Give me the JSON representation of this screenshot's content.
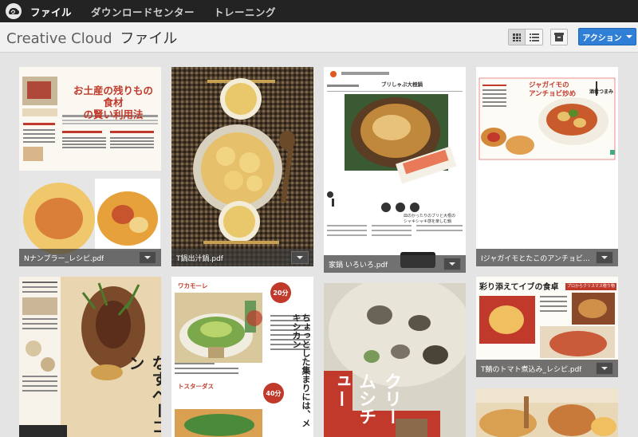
{
  "nav": {
    "items": [
      {
        "label": "ファイル"
      },
      {
        "label": "ダウンロードセンター"
      },
      {
        "label": "トレーニング"
      }
    ]
  },
  "header": {
    "brand": "Creative Cloud",
    "section": "ファイル",
    "action_label": "アクション"
  },
  "files": [
    {
      "name": "Nナンプラー_レシピ.pdf"
    },
    {
      "name": "T鍋出汁鍋.pdf"
    },
    {
      "name": "家鍋 いろいろ.pdf"
    },
    {
      "name": "Iジャガイモとたこのアンチョビ炒..."
    },
    {
      "name": ""
    },
    {
      "name": ""
    },
    {
      "name": ""
    },
    {
      "name": "T鯖のトマト煮込み_レシピ.pdf"
    },
    {
      "name": ""
    }
  ],
  "thumb_text": {
    "t1_headline1": "お土産の残りもの食材",
    "t1_headline2": "の賢い利用法",
    "t3_title": "ブリしゃぶ大根鍋",
    "t3_caption1": "皿のかったりのブリと大根の",
    "t3_caption2": "シャキシャキ感を楽しむ鍋",
    "t4_title1": "ジャガイモの",
    "t4_title2": "アンチョビ炒め",
    "t4_tag": "酒肴つまみ",
    "t6_label1": "ワカモーレ",
    "t6_badge1": "20分",
    "t6_label2": "トスターダス",
    "t6_badge2": "40分",
    "t6_vertical": "ちょっとした集まりには、メキシカン",
    "t5_vertical": "なすベーコン",
    "t7_vertical": "クリームシチュー",
    "t8_header": "彩り添えてイブの食卓",
    "t8_tag": "プロからクリスマス贈り物"
  },
  "colors": {
    "accent": "#2f7fd6",
    "nav_bg": "#232323",
    "header_bg": "#f1f1f1",
    "grid_bg": "#e4e4e4"
  }
}
